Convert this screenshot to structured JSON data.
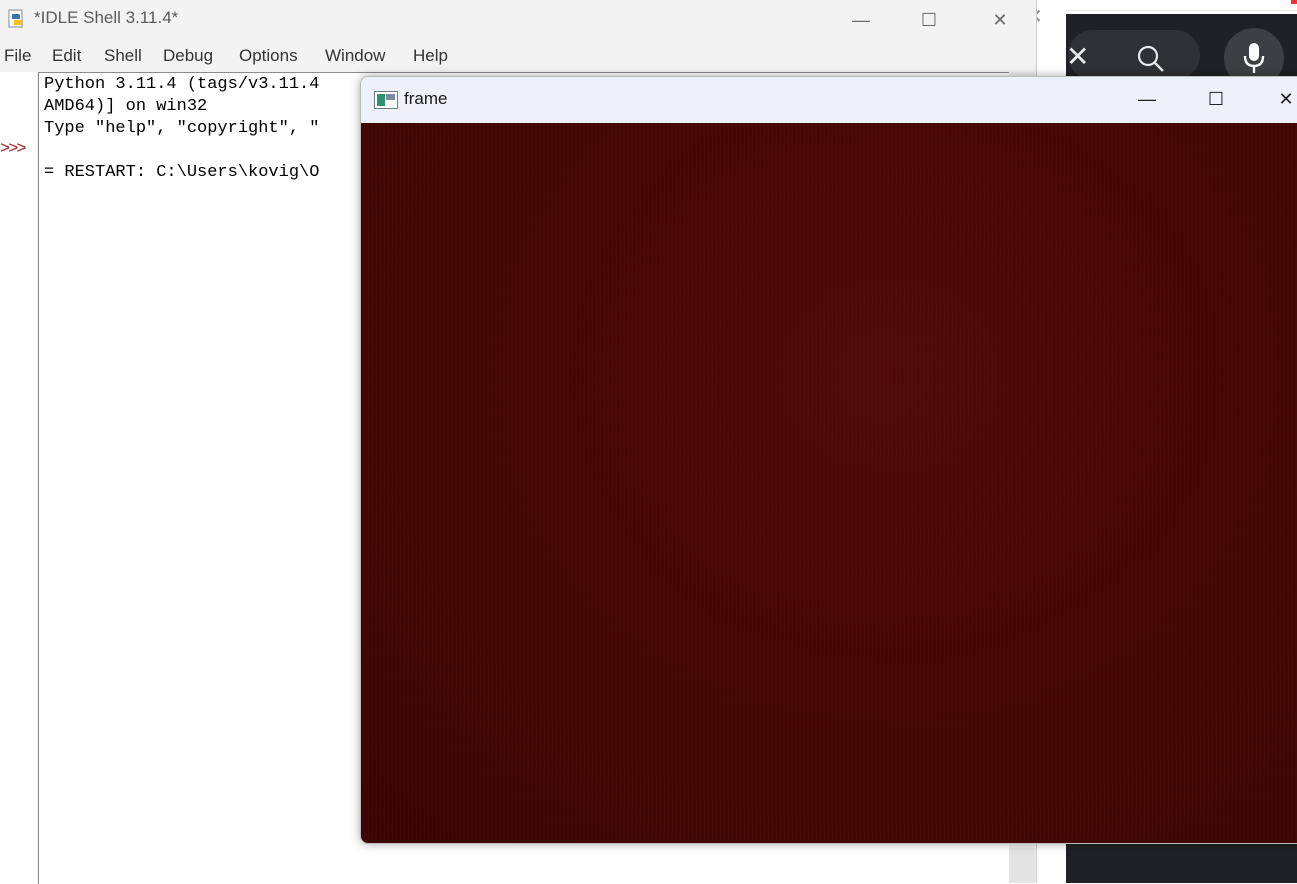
{
  "idle": {
    "title": "*IDLE Shell 3.11.4*",
    "menu": [
      "File",
      "Edit",
      "Shell",
      "Debug",
      "Options",
      "Window",
      "Help"
    ],
    "prompt": ">>>",
    "lines": [
      "Python 3.11.4 (tags/v3.11.4",
      "AMD64)] on win32",
      "Type \"help\", \"copyright\", \"",
      "",
      "= RESTART: C:\\Users\\kovig\\O"
    ],
    "window_controls": {
      "minimize": "—",
      "maximize": "☐",
      "close": "✕"
    }
  },
  "frame": {
    "title": "frame",
    "window_controls": {
      "minimize": "—",
      "maximize": "☐",
      "close": "✕"
    },
    "content_color": "#470705"
  },
  "background_app": {
    "close_glyph": "✕",
    "icons": [
      "search-icon",
      "microphone-icon"
    ]
  }
}
